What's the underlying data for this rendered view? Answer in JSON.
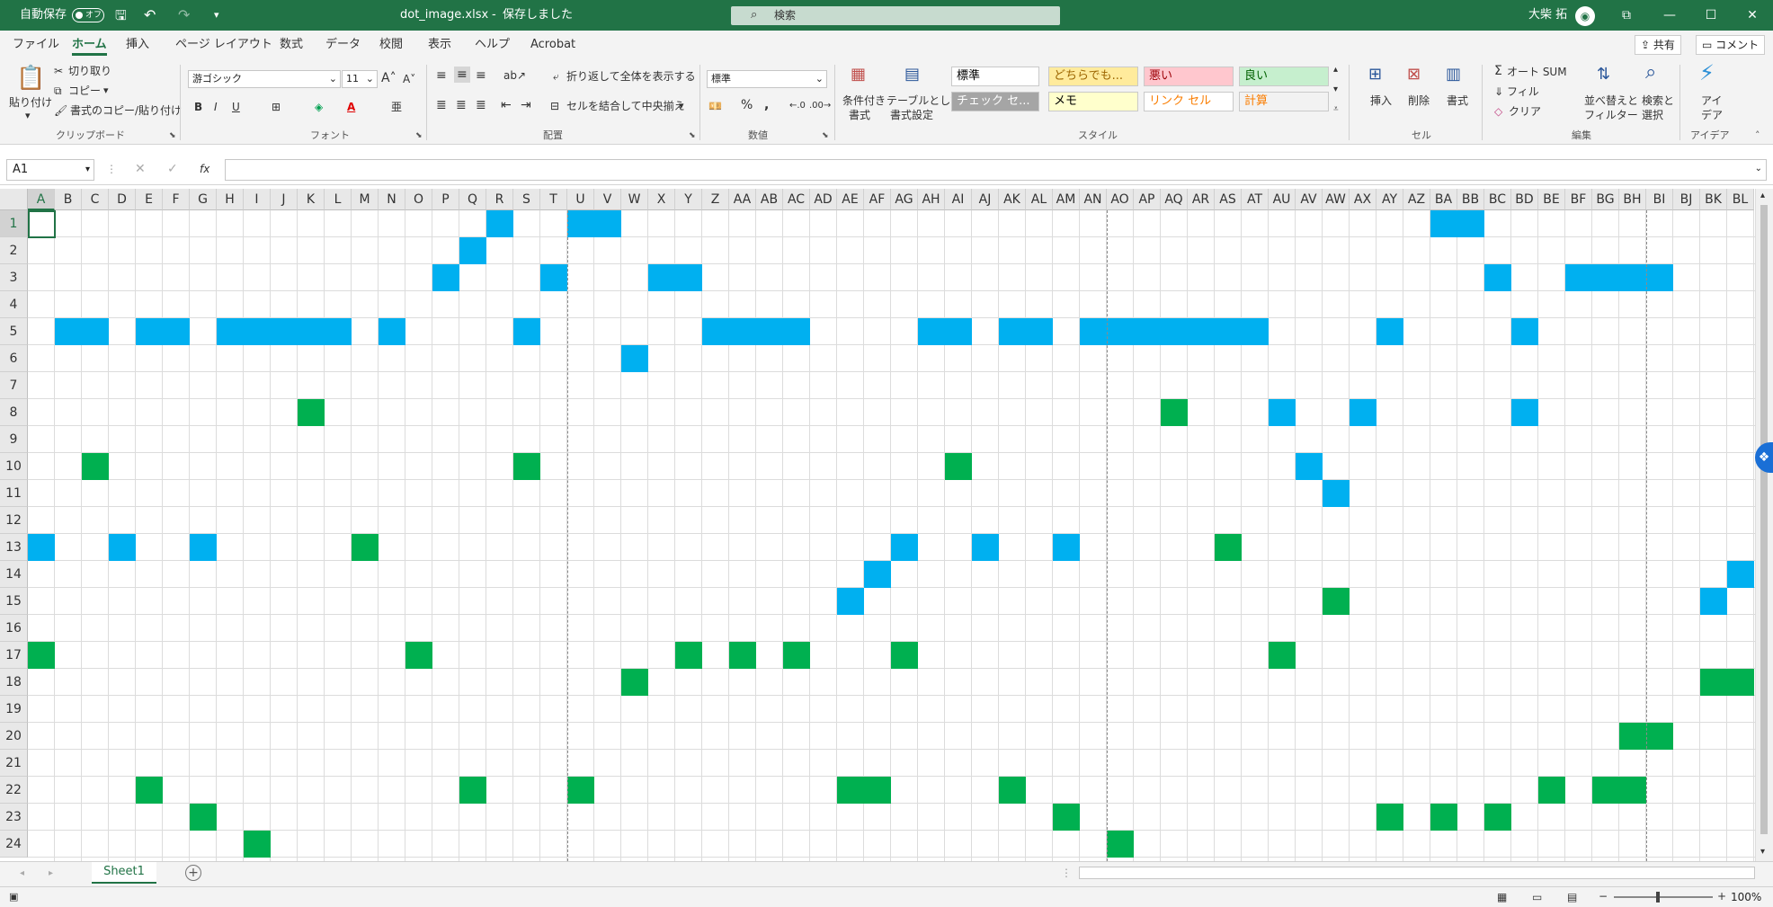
{
  "titlebar": {
    "autosave_label": "自動保存",
    "autosave_state": "オフ",
    "filename": "dot_image.xlsx",
    "save_status": "保存しました",
    "search_placeholder": "検索",
    "user_name": "大柴 拓"
  },
  "tabs": [
    "ファイル",
    "ホーム",
    "挿入",
    "ページ レイアウト",
    "数式",
    "データ",
    "校閲",
    "表示",
    "ヘルプ",
    "Acrobat"
  ],
  "active_tab": "ホーム",
  "tab_buttons": {
    "share": "共有",
    "comment": "コメント"
  },
  "ribbon": {
    "clipboard": {
      "paste": "貼り付け",
      "cut": "切り取り",
      "copy": "コピー",
      "format_painter": "書式のコピー/貼り付け",
      "label": "クリップボード"
    },
    "font": {
      "name": "游ゴシック",
      "size": "11",
      "label": "フォント"
    },
    "alignment": {
      "wrap": "折り返して全体を表示する",
      "merge": "セルを結合して中央揃え",
      "label": "配置"
    },
    "number": {
      "format": "標準",
      "label": "数値"
    },
    "styles": {
      "cond_format": [
        "条件付き",
        "書式"
      ],
      "table_format": [
        "テーブルとして",
        "書式設定"
      ],
      "cells": [
        {
          "text": "標準",
          "bg": "#ffffff",
          "fg": "#000000"
        },
        {
          "text": "どちらでも...",
          "bg": "#ffeb9c",
          "fg": "#9c6500"
        },
        {
          "text": "悪い",
          "bg": "#ffc7ce",
          "fg": "#9c0006"
        },
        {
          "text": "良い",
          "bg": "#c6efce",
          "fg": "#006100"
        },
        {
          "text": "チェック セ...",
          "bg": "#a5a5a5",
          "fg": "#ffffff"
        },
        {
          "text": "メモ",
          "bg": "#ffffcc",
          "fg": "#000000"
        },
        {
          "text": "リンク セル",
          "bg": "#ffffff",
          "fg": "#fa7d00"
        },
        {
          "text": "計算",
          "bg": "#f2f2f2",
          "fg": "#fa7d00"
        }
      ],
      "label": "スタイル"
    },
    "cells": {
      "insert": "挿入",
      "delete": "削除",
      "format": "書式",
      "label": "セル"
    },
    "editing": {
      "autosum": "オート SUM",
      "fill": "フィル",
      "clear": "クリア",
      "sort": [
        "並べ替えと",
        "フィルター"
      ],
      "find": [
        "検索と",
        "選択"
      ],
      "label": "編集"
    },
    "ideas": {
      "text": [
        "アイ",
        "デア"
      ],
      "label": "アイデア"
    }
  },
  "formula_bar": {
    "name_box": "A1",
    "fx": "fx",
    "value": ""
  },
  "columns": [
    "A",
    "B",
    "C",
    "D",
    "E",
    "F",
    "G",
    "H",
    "I",
    "J",
    "K",
    "L",
    "M",
    "N",
    "O",
    "P",
    "Q",
    "R",
    "S",
    "T",
    "U",
    "V",
    "W",
    "X",
    "Y",
    "Z",
    "AA",
    "AB",
    "AC",
    "AD",
    "AE",
    "AF",
    "AG",
    "AH",
    "AI",
    "AJ",
    "AK",
    "AL",
    "AM",
    "AN",
    "AO",
    "AP",
    "AQ",
    "AR",
    "AS",
    "AT",
    "AU",
    "AV",
    "AW",
    "AX",
    "AY",
    "AZ",
    "BA",
    "BB",
    "BC",
    "BD",
    "BE",
    "BF",
    "BG",
    "BH",
    "BI",
    "BJ",
    "BK",
    "BL"
  ],
  "rows": [
    "1",
    "2",
    "3",
    "4",
    "5",
    "6",
    "7",
    "8",
    "9",
    "10",
    "11",
    "12",
    "13",
    "14",
    "15",
    "16",
    "17",
    "18",
    "19",
    "20",
    "21",
    "22",
    "23",
    "24"
  ],
  "colors": {
    "blue": "#00b0f0",
    "green": "#00b050",
    "accent": "#217346"
  },
  "filled_cells": {
    "blue": [
      [
        1,
        17
      ],
      [
        1,
        20
      ],
      [
        1,
        21
      ],
      [
        1,
        52
      ],
      [
        1,
        53
      ],
      [
        2,
        16
      ],
      [
        3,
        15
      ],
      [
        3,
        19
      ],
      [
        3,
        23
      ],
      [
        3,
        24
      ],
      [
        3,
        54
      ],
      [
        3,
        57
      ],
      [
        3,
        58
      ],
      [
        3,
        59
      ],
      [
        3,
        60
      ],
      [
        5,
        1
      ],
      [
        5,
        2
      ],
      [
        5,
        4
      ],
      [
        5,
        5
      ],
      [
        5,
        7
      ],
      [
        5,
        8
      ],
      [
        5,
        9
      ],
      [
        5,
        10
      ],
      [
        5,
        11
      ],
      [
        5,
        13
      ],
      [
        5,
        18
      ],
      [
        5,
        25
      ],
      [
        5,
        26
      ],
      [
        5,
        27
      ],
      [
        5,
        28
      ],
      [
        5,
        33
      ],
      [
        5,
        34
      ],
      [
        5,
        36
      ],
      [
        5,
        37
      ],
      [
        5,
        39
      ],
      [
        5,
        40
      ],
      [
        5,
        41
      ],
      [
        5,
        42
      ],
      [
        5,
        43
      ],
      [
        5,
        44
      ],
      [
        5,
        45
      ],
      [
        5,
        50
      ],
      [
        5,
        55
      ],
      [
        6,
        22
      ],
      [
        8,
        46
      ],
      [
        8,
        49
      ],
      [
        8,
        55
      ],
      [
        10,
        47
      ],
      [
        11,
        48
      ],
      [
        13,
        0
      ],
      [
        13,
        3
      ],
      [
        13,
        6
      ],
      [
        13,
        32
      ],
      [
        13,
        35
      ],
      [
        13,
        38
      ],
      [
        14,
        31
      ],
      [
        14,
        63
      ],
      [
        15,
        30
      ],
      [
        15,
        62
      ]
    ],
    "green": [
      [
        8,
        10
      ],
      [
        8,
        42
      ],
      [
        10,
        2
      ],
      [
        10,
        18
      ],
      [
        10,
        34
      ],
      [
        13,
        12
      ],
      [
        13,
        44
      ],
      [
        15,
        48
      ],
      [
        17,
        0
      ],
      [
        17,
        14
      ],
      [
        17,
        24
      ],
      [
        17,
        26
      ],
      [
        17,
        28
      ],
      [
        17,
        32
      ],
      [
        17,
        46
      ],
      [
        18,
        22
      ],
      [
        18,
        62
      ],
      [
        18,
        63
      ],
      [
        20,
        59
      ],
      [
        20,
        60
      ],
      [
        22,
        4
      ],
      [
        22,
        16
      ],
      [
        22,
        20
      ],
      [
        22,
        30
      ],
      [
        22,
        31
      ],
      [
        22,
        36
      ],
      [
        22,
        56
      ],
      [
        22,
        58
      ],
      [
        22,
        59
      ],
      [
        23,
        6
      ],
      [
        23,
        38
      ],
      [
        23,
        50
      ],
      [
        23,
        52
      ],
      [
        23,
        54
      ],
      [
        24,
        8
      ],
      [
        24,
        40
      ]
    ]
  },
  "sheet_tab": "Sheet1",
  "status": {
    "zoom": "100%"
  }
}
